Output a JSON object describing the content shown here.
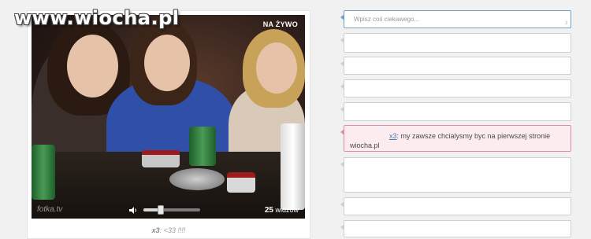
{
  "watermark": "www.wiocha.pl",
  "video": {
    "live_badge": "NA ŻYWO",
    "logo_text": "fotka.tv",
    "volume_level": 0.3,
    "viewers_count": "25",
    "viewers_label": "widzów"
  },
  "caption": {
    "user": "x3",
    "separator": ":",
    "text": "<33 !!!!"
  },
  "chat": {
    "input_placeholder": "Wpisz coś ciekawego...",
    "resize_glyph": ".:i",
    "messages": [
      {
        "user": "x3",
        "text": "my zawsze chcialysmy byc na pierwszej stronie wiocha.pl"
      }
    ]
  }
}
